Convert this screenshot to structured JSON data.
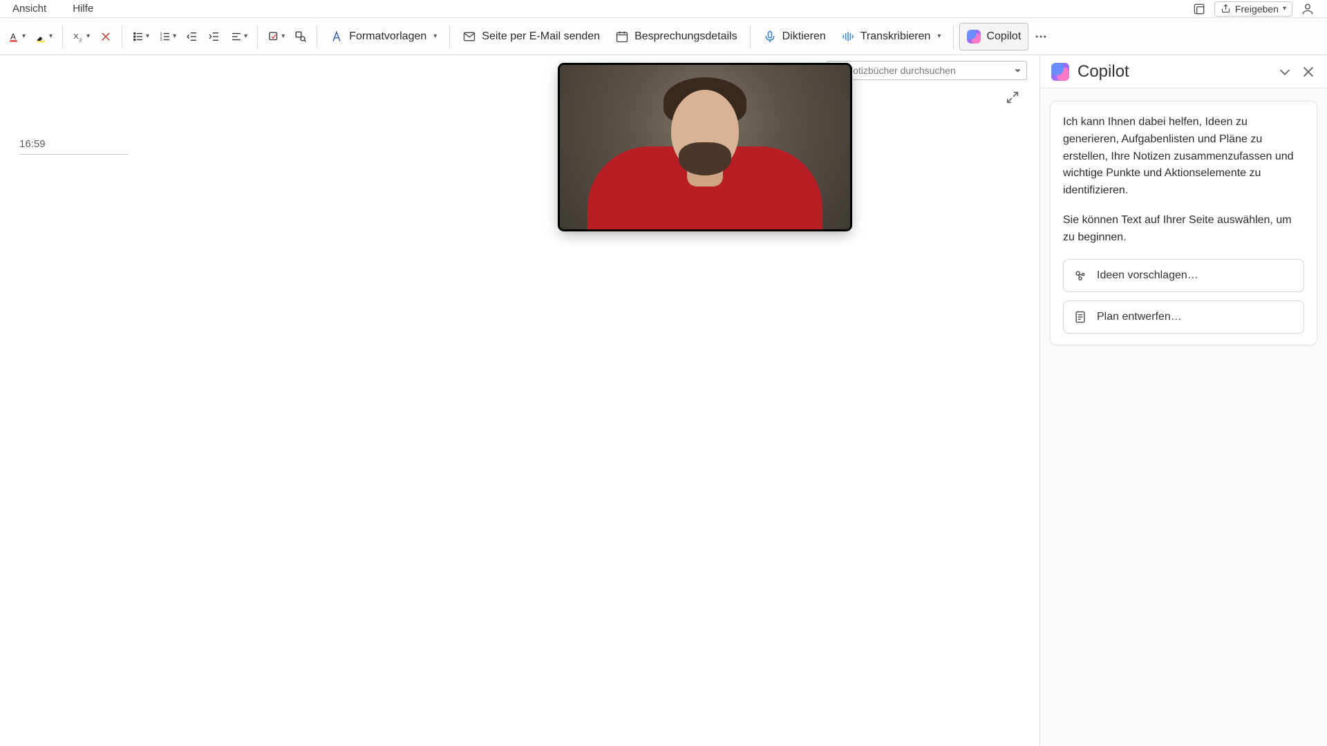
{
  "menu": {
    "view": "Ansicht",
    "help": "Hilfe",
    "share": "Freigeben"
  },
  "ribbon": {
    "styles": "Formatvorlagen",
    "email_page": "Seite per E-Mail senden",
    "meeting_details": "Besprechungsdetails",
    "dictate": "Diktieren",
    "transcribe": "Transkribieren",
    "copilot": "Copilot"
  },
  "page": {
    "search_placeholder": "Notizbücher durchsuchen",
    "timestamp": "16:59"
  },
  "copilot": {
    "title": "Copilot",
    "intro": "Ich kann Ihnen dabei helfen, Ideen zu generieren, Aufgabenlisten und Pläne zu erstellen, Ihre Notizen zusammenzufassen und wichtige Punkte und Aktionselemente zu identifizieren.",
    "hint": "Sie können Text auf Ihrer Seite auswählen, um zu beginnen.",
    "suggest_ideas": "Ideen vorschlagen…",
    "draft_plan": "Plan entwerfen…"
  }
}
